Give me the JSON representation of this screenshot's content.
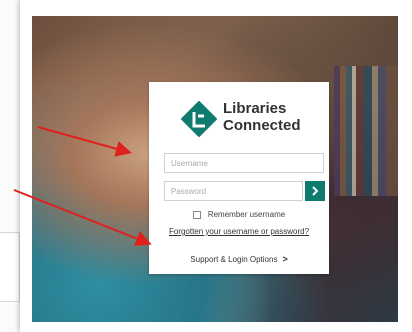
{
  "logo": {
    "line1": "Libraries",
    "line2": "Connected",
    "icon": "libraries-connected-logo-icon"
  },
  "login": {
    "username_placeholder": "Username",
    "password_placeholder": "Password",
    "submit_icon": "chevron-right-icon",
    "remember_label": "Remember username",
    "forgot_link": "Forgotten your username or password?",
    "support_link": "Support & Login Options",
    "support_chevron": ">"
  },
  "colors": {
    "brand_teal": "#0f7a6e",
    "arrow": "#e0201c"
  }
}
